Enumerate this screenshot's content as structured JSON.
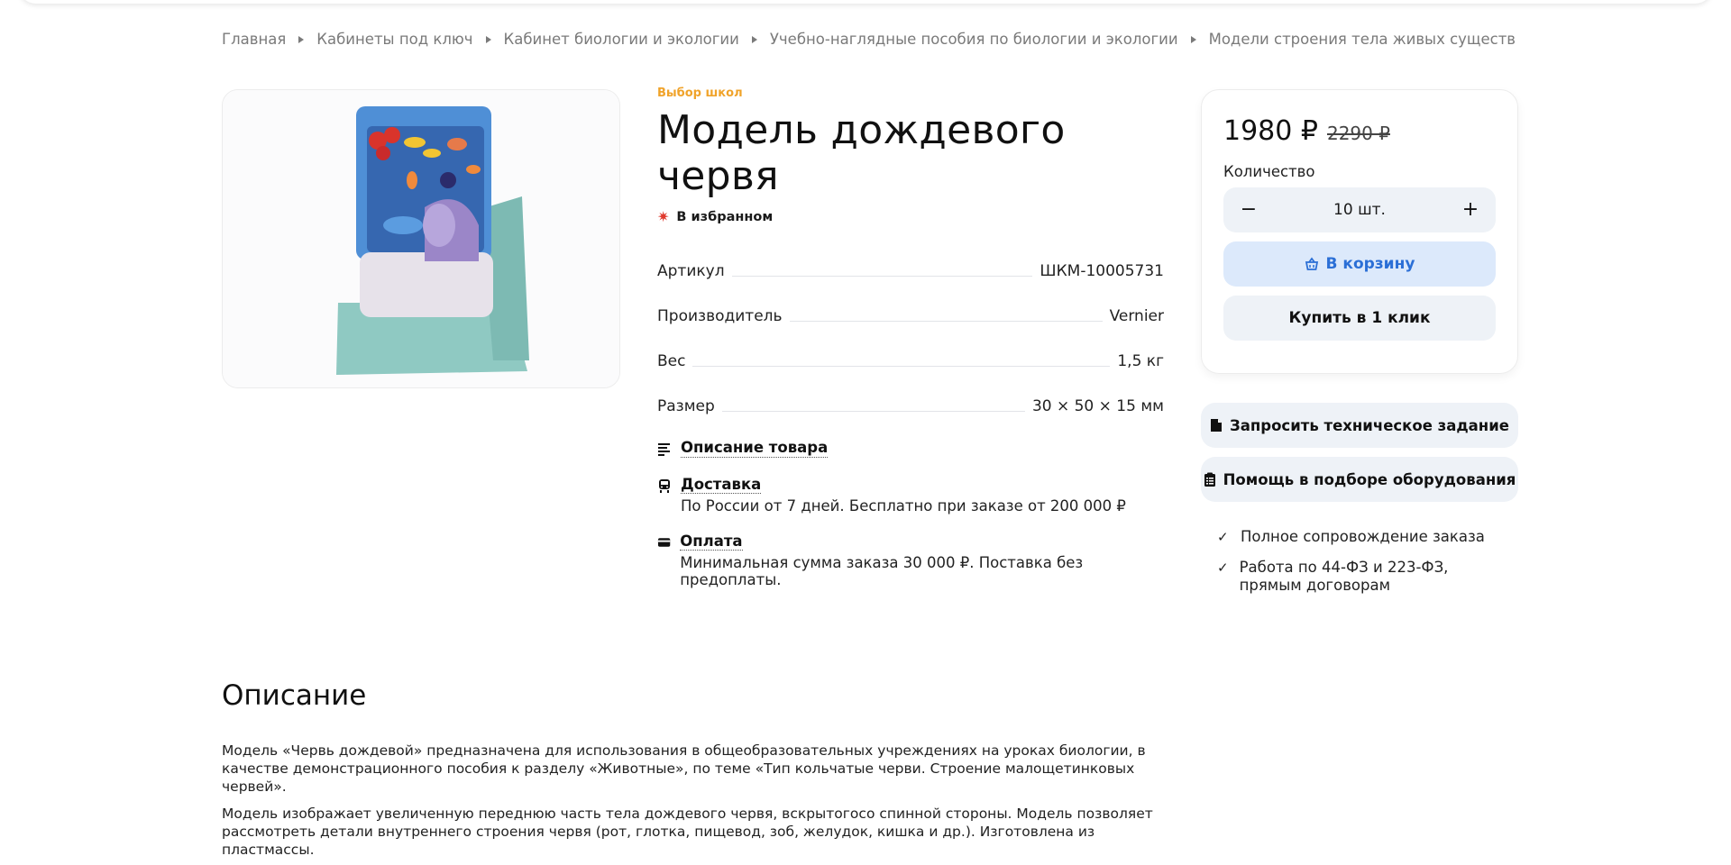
{
  "breadcrumb": [
    "Главная",
    "Кабинеты под ключ",
    "Кабинет биологии и экологии",
    "Учебно-наглядные пособия по биологии и экологии",
    "Модели строения тела живых существ"
  ],
  "product": {
    "brand": "Выбор школ",
    "title": "Модель дождевого червя",
    "favorite_label": "В избранном",
    "image_alt": "model-photo",
    "properties": [
      {
        "name": "Артикул",
        "value": "ШКМ-10005731"
      },
      {
        "name": "Производитель",
        "value": "Vernier"
      },
      {
        "name": "Вес",
        "value": "1,5 кг"
      },
      {
        "name": "Размер",
        "value": "30 × 50 × 15 мм"
      }
    ],
    "sections": {
      "description_link": "Описание товара",
      "delivery_title": "Доставка",
      "delivery_text": "По России от 7 дней. Бесплатно при заказе от 200 000 ₽",
      "payment_title": "Оплата",
      "payment_text": "Минимальная сумма заказа 30 000 ₽. Поставка без предоплаты."
    }
  },
  "buy": {
    "price": "1980 ₽",
    "old_price": "2290 ₽",
    "qty_label": "Количество",
    "qty_value": "10 шт.",
    "minus": "−",
    "plus": "+",
    "cart_label": "В корзину",
    "one_click_label": "Купить в 1 клик"
  },
  "side": {
    "request_spec": "Запросить техническое задание",
    "help_selection": "Помощь в подборе оборудования",
    "checks": [
      "Полное сопровождение заказа",
      "Работа по 44-ФЗ и 223-ФЗ, прямым договорам"
    ]
  },
  "description": {
    "heading": "Описание",
    "paragraphs": [
      "Модель «Червь дождевой» предназначена для использования в общеобразовательных учреждениях на уроках биологии, в качестве демонстрационного пособия к разделу «Животные», по теме «Тип кольчатые черви. Строение малощетинковых червей».",
      "Модель изображает увеличенную переднюю часть тела дождевого червя, вскрытогосо спинной стороны. Модель позволяет рассмотреть детали внутреннего строения червя (рот, глотка, пищевод, зоб, желудок, кишка и др.). Изготовлена из пластмассы."
    ]
  },
  "colors": {
    "brand": "#f0a32a",
    "accent_blue": "#2b6fd6",
    "cart_bg": "#dce9fb",
    "button_bg": "#eef2f7",
    "favorite": "#e0392d"
  }
}
